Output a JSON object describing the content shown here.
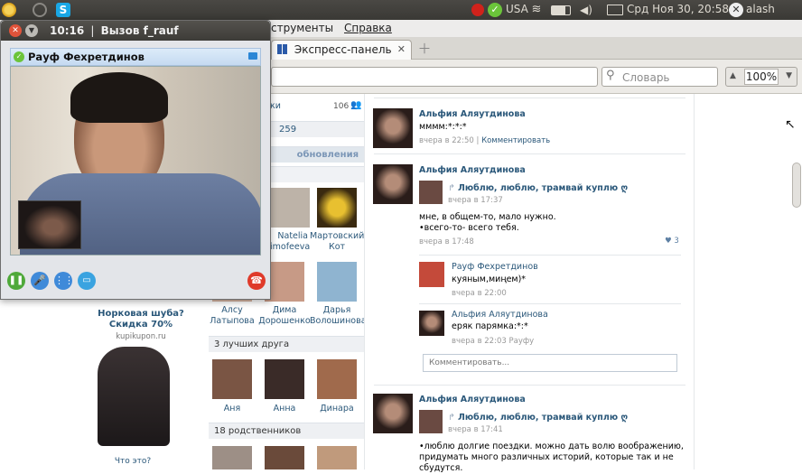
{
  "panel": {
    "indicator_text": "USA",
    "datetime": "Срд Ноя 30, 20:58",
    "user": "alash"
  },
  "menubar": {
    "tools": "струменты",
    "help": "Справка"
  },
  "tabs": [
    {
      "label": "Экспресс-панель"
    }
  ],
  "nav": {
    "search_placeholder": "Словарь",
    "zoom": "100%"
  },
  "skype": {
    "title_time": "10:16",
    "title_sep": "|",
    "title_call": "Вызов f_rauf",
    "contact_name": "Рауф Фехретдинов"
  },
  "left": {
    "ad_title": "Норковая шуба?",
    "ad_sub": "Скидка 70%",
    "ad_site": "kupikupon.ru",
    "ad_what": "Что это?"
  },
  "middle": {
    "top_label": "ки",
    "top_count": "106",
    "count2": "259",
    "updates": "обновления",
    "friends": [
      {
        "first": "Natelia",
        "last": "imofeeva"
      },
      {
        "first": "Мартовский",
        "last": "Кот"
      },
      {
        "first": "Алсу",
        "last": "Латыпова"
      },
      {
        "first": "Дима",
        "last": "Дорошенко"
      },
      {
        "first": "Дарья",
        "last": "Волошинова"
      }
    ],
    "best_header": "3 лучших друга",
    "best": [
      "Аня",
      "Анна",
      "Динара"
    ],
    "relatives_header": "18 родственников"
  },
  "feed": {
    "post1": {
      "author": "Альфия Аляутдинова",
      "text": "мммм:*:*:*",
      "time": "вчера в 22:50",
      "sep": "|",
      "comment": "Комментировать"
    },
    "post2": {
      "author": "Альфия Аляутдинова",
      "repost_title": "Люблю, люблю, трамвай куплю ღ",
      "repost_time": "вчера в 17:37",
      "text1": "мне, в общем-то, мало нужно.",
      "text2": "•всего-то- всего тебя.",
      "time": "вчера в 17:48",
      "likes": "3"
    },
    "comment1": {
      "author": "Рауф Фехретдинов",
      "text": "куяным,миңем)*",
      "time": "вчера в 22:00"
    },
    "comment2": {
      "author": "Альфия Аляутдинова",
      "text": "еряк парямка:*:*",
      "time": "вчера в 22:03",
      "to": "Рауфу"
    },
    "comment_placeholder": "Комментировать...",
    "post3": {
      "author": "Альфия Аляутдинова",
      "repost_title": "Люблю, люблю, трамвай куплю ღ",
      "repost_time": "вчера в 17:41",
      "text1": "•люблю долгие поездки. можно дать волю воображению,",
      "text2": "придумать много различных историй, которые так и не",
      "text3": "сбудутся."
    }
  }
}
